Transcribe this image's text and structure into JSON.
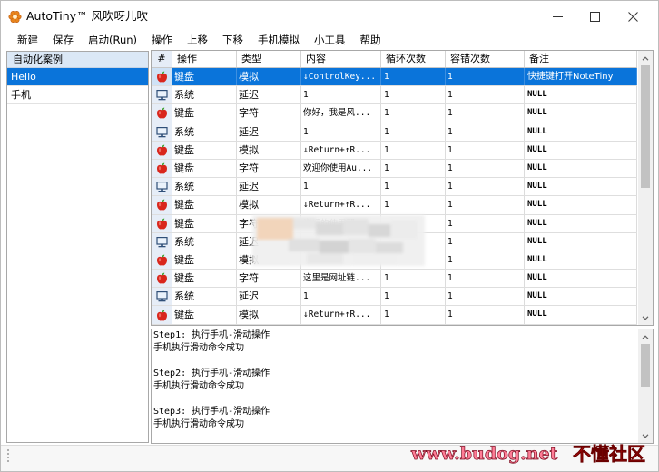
{
  "window": {
    "title": "AutoTiny™ 风吹呀儿吹",
    "app_icon": "flower-app-icon",
    "controls": [
      "minimize-icon",
      "maximize-icon",
      "close-icon"
    ]
  },
  "menu": {
    "items": [
      "新建",
      "保存",
      "启动(Run)",
      "操作",
      "上移",
      "下移",
      "手机模拟",
      "小工具",
      "帮助"
    ]
  },
  "cases": {
    "header": "自动化案例",
    "items": [
      {
        "label": "Hello",
        "selected": true
      },
      {
        "label": "手机",
        "selected": false
      }
    ]
  },
  "grid": {
    "columns": [
      "#",
      "操作",
      "类型",
      "内容",
      "循环次数",
      "容错次数",
      "备注"
    ],
    "rows": [
      {
        "icon": "apple-icon",
        "action": "键盘",
        "type": "模拟",
        "content": "↓ControlKey...",
        "loop": "1",
        "retry": "1",
        "note": "快捷键打开NoteTiny",
        "selected": true
      },
      {
        "icon": "monitor-icon",
        "action": "系统",
        "type": "延迟",
        "content": "1",
        "loop": "1",
        "retry": "1",
        "note": "NULL"
      },
      {
        "icon": "apple-icon",
        "action": "键盘",
        "type": "字符",
        "content": "你好，我是风...",
        "loop": "1",
        "retry": "1",
        "note": "NULL"
      },
      {
        "icon": "monitor-icon",
        "action": "系统",
        "type": "延迟",
        "content": "1",
        "loop": "1",
        "retry": "1",
        "note": "NULL"
      },
      {
        "icon": "apple-icon",
        "action": "键盘",
        "type": "模拟",
        "content": "↓Return+↑R...",
        "loop": "1",
        "retry": "1",
        "note": "NULL"
      },
      {
        "icon": "apple-icon",
        "action": "键盘",
        "type": "字符",
        "content": "欢迎你使用Au...",
        "loop": "1",
        "retry": "1",
        "note": "NULL"
      },
      {
        "icon": "monitor-icon",
        "action": "系统",
        "type": "延迟",
        "content": "1",
        "loop": "1",
        "retry": "1",
        "note": "NULL"
      },
      {
        "icon": "apple-icon",
        "action": "键盘",
        "type": "模拟",
        "content": "↓Return+↑R...",
        "loop": "1",
        "retry": "1",
        "note": "NULL"
      },
      {
        "icon": "apple-icon",
        "action": "键盘",
        "type": "字符",
        "content": "详细的使用帮...",
        "loop": "",
        "retry": "1",
        "note": "NULL"
      },
      {
        "icon": "monitor-icon",
        "action": "系统",
        "type": "延迟",
        "content": "",
        "loop": "",
        "retry": "1",
        "note": "NULL"
      },
      {
        "icon": "apple-icon",
        "action": "键盘",
        "type": "模拟",
        "content": "",
        "loop": "",
        "retry": "1",
        "note": "NULL"
      },
      {
        "icon": "apple-icon",
        "action": "键盘",
        "type": "字符",
        "content": "这里是网址链...",
        "loop": "1",
        "retry": "1",
        "note": "NULL"
      },
      {
        "icon": "monitor-icon",
        "action": "系统",
        "type": "延迟",
        "content": "1",
        "loop": "1",
        "retry": "1",
        "note": "NULL"
      },
      {
        "icon": "apple-icon",
        "action": "键盘",
        "type": "模拟",
        "content": "↓Return+↑R...",
        "loop": "1",
        "retry": "1",
        "note": "NULL"
      }
    ]
  },
  "log": {
    "steps": [
      {
        "step": "Step1: 执行手机-滑动操作",
        "result": "手机执行滑动命令成功"
      },
      {
        "step": "Step2: 执行手机-滑动操作",
        "result": "手机执行滑动命令成功"
      },
      {
        "step": "Step3: 执行手机-滑动操作",
        "result": "手机执行滑动命令成功"
      }
    ]
  },
  "watermark": {
    "url": "www.budog.net",
    "name": "不懂社区"
  },
  "colors": {
    "selection": "#0a74da",
    "index_column": "#e6edf7",
    "apple_icon": "#d9261c",
    "monitor_icon": "#2f4f78",
    "watermark_url": "#ff7d96",
    "watermark_name": "#ff1a1a"
  }
}
